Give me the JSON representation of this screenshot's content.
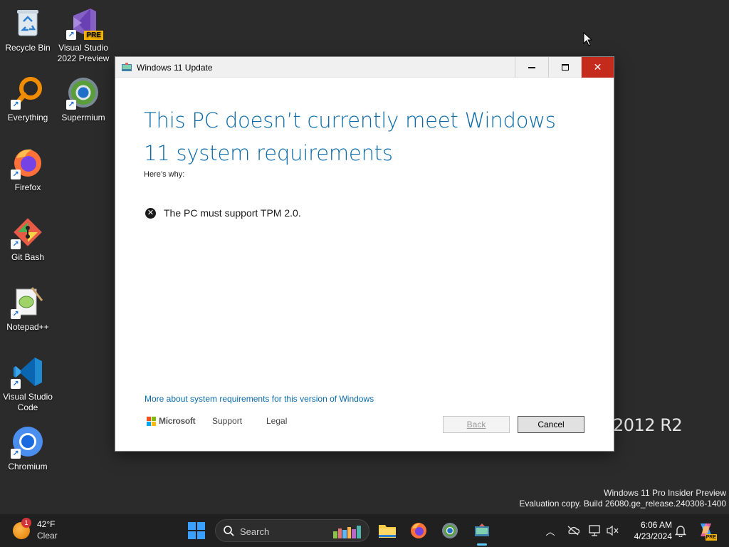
{
  "desktop": {
    "icons": [
      {
        "label": "Recycle Bin"
      },
      {
        "label": "Visual Studio 2022 Preview",
        "badge": "PRE"
      },
      {
        "label": "Everything"
      },
      {
        "label": "Supermium"
      },
      {
        "label": "Firefox"
      },
      {
        "label": "Git Bash"
      },
      {
        "label": "Notepad++"
      },
      {
        "label": "Visual Studio Code"
      },
      {
        "label": "Chromium"
      }
    ],
    "server_watermark": "2012 R2",
    "edition_line1": "Windows 11 Pro Insider Preview",
    "edition_line2": "Evaluation copy. Build 26080.ge_release.240308-1400"
  },
  "window": {
    "title": "Windows 11 Update",
    "heading": "This PC doesn’t currently meet Windows 11 system requirements",
    "subheading": "Here’s why:",
    "requirements": [
      {
        "icon": "error-x-icon",
        "text": "The PC must support TPM 2.0."
      }
    ],
    "more_link": "More about system requirements for this version of Windows",
    "footer": {
      "brand": "Microsoft",
      "support": "Support",
      "legal": "Legal"
    },
    "buttons": {
      "back": "Back",
      "cancel": "Cancel"
    },
    "controls": {
      "minimize": "—",
      "maximize": "☐",
      "close": "✕"
    }
  },
  "taskbar": {
    "weather": {
      "badge": "1",
      "temp": "42°F",
      "condition": "Clear"
    },
    "search_placeholder": "Search",
    "clock": {
      "time": "6:06 AM",
      "date": "4/23/2024"
    },
    "pinned": [
      "start-icon",
      "file-explorer-icon",
      "firefox-icon",
      "supermium-icon",
      "windows-update-icon"
    ],
    "copilot_badge": "PRE"
  },
  "colors": {
    "desktop_bg": "#2b2b2b",
    "heading_blue": "#0a6aa8",
    "close_red": "#c42b1c",
    "taskbar_bg": "#202020"
  }
}
